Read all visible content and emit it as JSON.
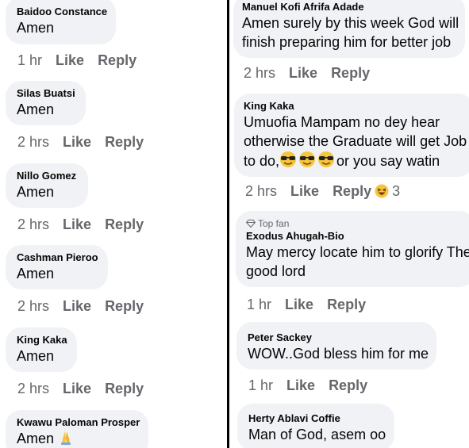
{
  "left_comments": [
    {
      "author": "Baidoo Constance",
      "text": "Amen",
      "time": "1 hr",
      "like": "Like",
      "reply": "Reply"
    },
    {
      "author": "Silas Buatsi",
      "text": "Amen",
      "time": "2 hrs",
      "like": "Like",
      "reply": "Reply"
    },
    {
      "author": "Nillo Gomez",
      "text": "Amen",
      "time": "2 hrs",
      "like": "Like",
      "reply": "Reply"
    },
    {
      "author": "Cashman Pieroo",
      "text": "Amen",
      "time": "2 hrs",
      "like": "Like",
      "reply": "Reply"
    },
    {
      "author": "King Kaka",
      "text": "Amen",
      "time": "2 hrs",
      "like": "Like",
      "reply": "Reply"
    },
    {
      "author": "Kwawu Paloman Prosper",
      "text": "Amen",
      "emoji": "folded-hands-icon"
    }
  ],
  "right_comments": [
    {
      "author": "Manuel Kofi Afrifa Adade",
      "line1": "Amen surely by this week God will",
      "line2": "finish preparing him for better job",
      "time": "2 hrs",
      "like": "Like",
      "reply": "Reply"
    },
    {
      "author": "King Kaka",
      "line1": "Umuofia Mampam no dey hear",
      "line2": "otherwise the Graduate will get Job",
      "line3a": "to do,",
      "emoji": "sunglasses-face-icon",
      "line3b": "or you say watin",
      "time": "2 hrs",
      "like": "Like",
      "reply": "Reply",
      "reaction_count": "3",
      "reaction_icon": "laughing-face-icon"
    },
    {
      "badge": "Top fan",
      "author": "Exodus Ahugah-Bio",
      "line1": "May mercy locate him to glorify The",
      "line2": "good lord",
      "time": "1 hr",
      "like": "Like",
      "reply": "Reply"
    },
    {
      "author": "Peter Sackey",
      "line1": "WOW..God bless him for me",
      "time": "1 hr",
      "like": "Like",
      "reply": "Reply"
    },
    {
      "author": "Herty Ablavi Coffie",
      "line1": "Man of God, asem oo"
    }
  ],
  "colors": {
    "bubble": "#f0f2f5",
    "meta": "#65676b",
    "text": "#050505",
    "divider": "#000000"
  }
}
